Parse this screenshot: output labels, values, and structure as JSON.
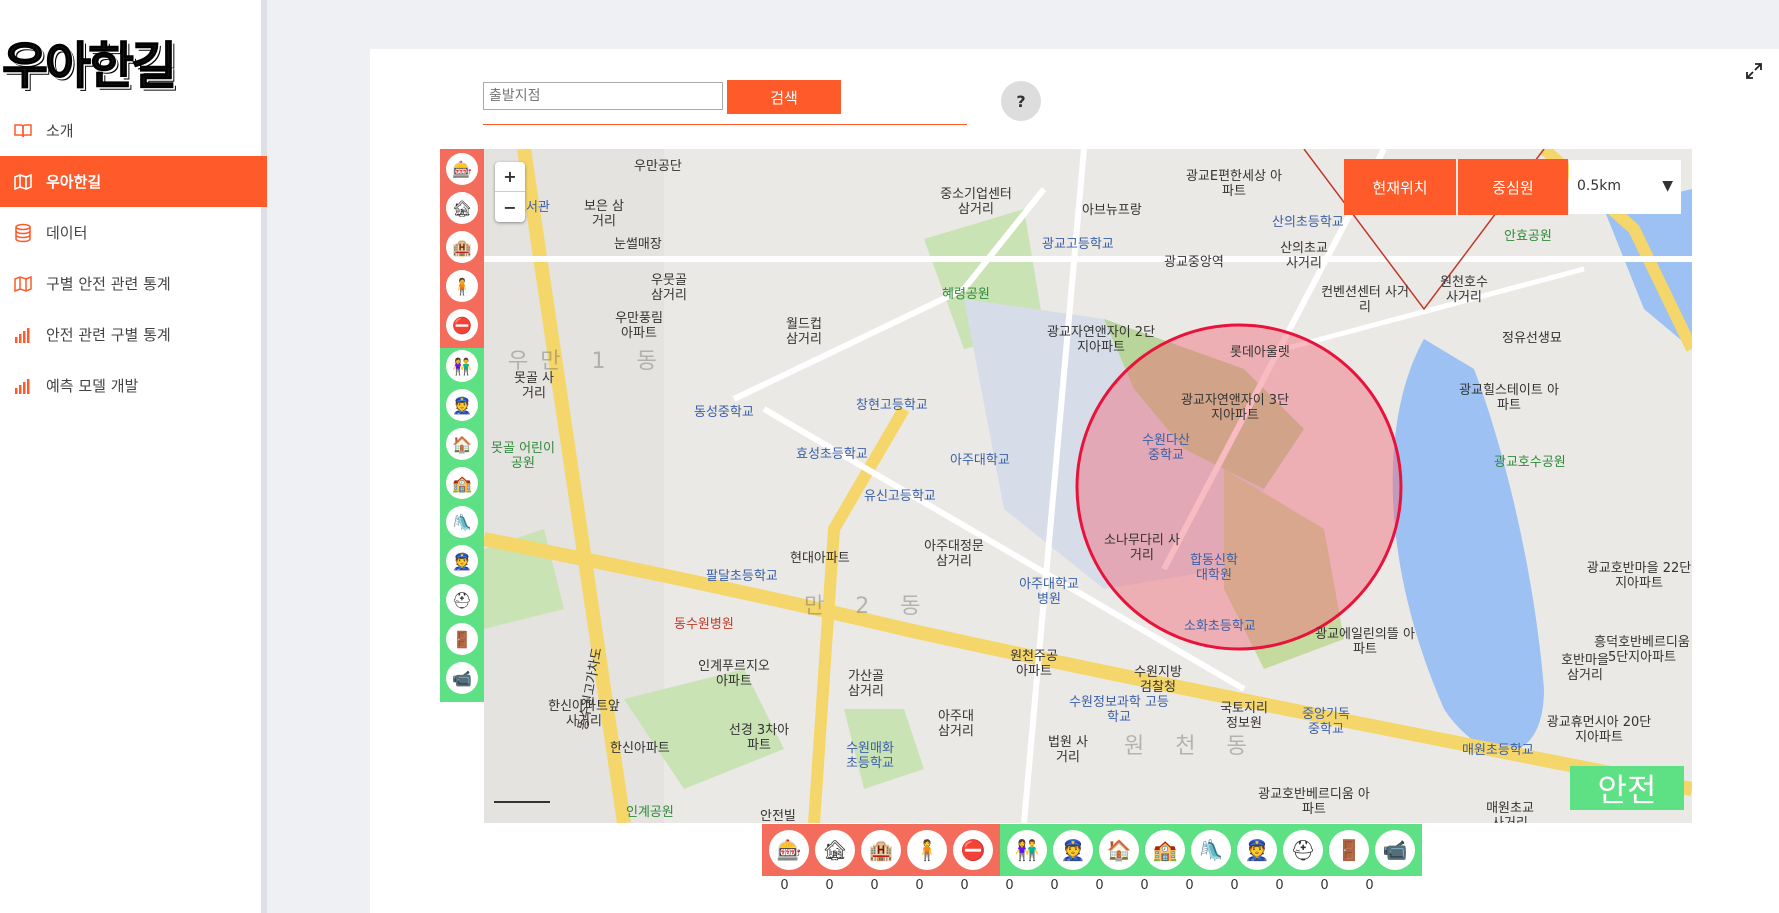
{
  "logo": "우아한길",
  "menu": [
    {
      "label": "소개",
      "icon": "book-icon"
    },
    {
      "label": "우아한길",
      "icon": "map-icon",
      "active": true
    },
    {
      "label": "데이터",
      "icon": "database-icon"
    },
    {
      "label": "구별 안전 관련 통계",
      "icon": "map-icon"
    },
    {
      "label": "안전 관련 구별 통계",
      "icon": "bar-chart-icon"
    },
    {
      "label": "예측 모델 개발",
      "icon": "bar-chart-icon"
    }
  ],
  "search": {
    "placeholder": "출발지점",
    "button": "검색",
    "help": "?"
  },
  "map": {
    "zoom_in": "+",
    "zoom_out": "−",
    "current_location": "현재위치",
    "center_circle": "중심원",
    "radius": "0.5km",
    "safety_status": "안전",
    "labels": [
      "우만공단",
      "도서관",
      "보은 삼거리",
      "눈썰매장",
      "우만풍림 아파트",
      "우뭇골 삼거리",
      "월드컵 삼거리",
      "우만 1 동",
      "못골 사거리",
      "못골 어린이공원",
      "동성중학교",
      "창현고등학교",
      "효성초등학교",
      "유신고등학교",
      "아주대학교",
      "아주대정문 삼거리",
      "현대아파트",
      "팔달초등학교",
      "동수원병원",
      "인계푸르지오 아파트",
      "한신아파트앞 사거리",
      "한신아파트",
      "선경 3차아파트",
      "수원매화 초등학교",
      "인계공원",
      "가산골 삼거리",
      "아주대 삼거리",
      "법원 사거리",
      "원천주공 아파트",
      "수원정보과학 고등학교",
      "수원지방 검찰청",
      "국토지리 정보원",
      "중앙기독 중학교",
      "소나무다리 사거리",
      "아주대학교 병원",
      "합동신학 대학원",
      "수원다산 중학교",
      "광교자연앤자이 2단지아파트",
      "광교자연앤자이 3단지아파트",
      "롯데아울렛",
      "혜령공원",
      "중소기업센터 삼거리",
      "광교고등학교",
      "광교중앙역",
      "아브뉴프랑",
      "광교E편한세상 아파트",
      "산의초등학교",
      "산의초교 사거리",
      "컨벤션센터 사거리",
      "원천호수 사거리",
      "안효공원",
      "정유선생묘",
      "광교힐스테이트 아파트",
      "광교호수공원",
      "광교호반마을 22단지아파트",
      "흥덕호반베르디움 5단지아파트",
      "호반마을 삼거리",
      "광교휴먼시아 20단지아파트",
      "매원초등학교",
      "광교에일린의뜰 아파트",
      "광교호반베르디움 아파트",
      "소화초등학교",
      "원 천 동",
      "만 2 동",
      "동수원고가차도",
      "안전빌",
      "매원초교 사거리"
    ]
  },
  "filters_top": [
    "entertainment-icon",
    "lodging-icon",
    "hotel-icon",
    "adult-icon",
    "age-restricted-icon"
  ],
  "filters_bottom": [
    "children-icon",
    "guard-icon",
    "police-station-icon",
    "school-icon",
    "playground-icon",
    "police-icon",
    "helmet-icon",
    "emergency-bell-icon",
    "cctv-icon"
  ],
  "counts": [
    "0",
    "0",
    "0",
    "0",
    "0",
    "0",
    "0",
    "0",
    "0",
    "0",
    "0",
    "0",
    "0",
    "0"
  ],
  "colors": {
    "accent": "#ff5a2a",
    "danger": "#f46d5c",
    "safe": "#5ee085",
    "circle": "#e8123a"
  }
}
